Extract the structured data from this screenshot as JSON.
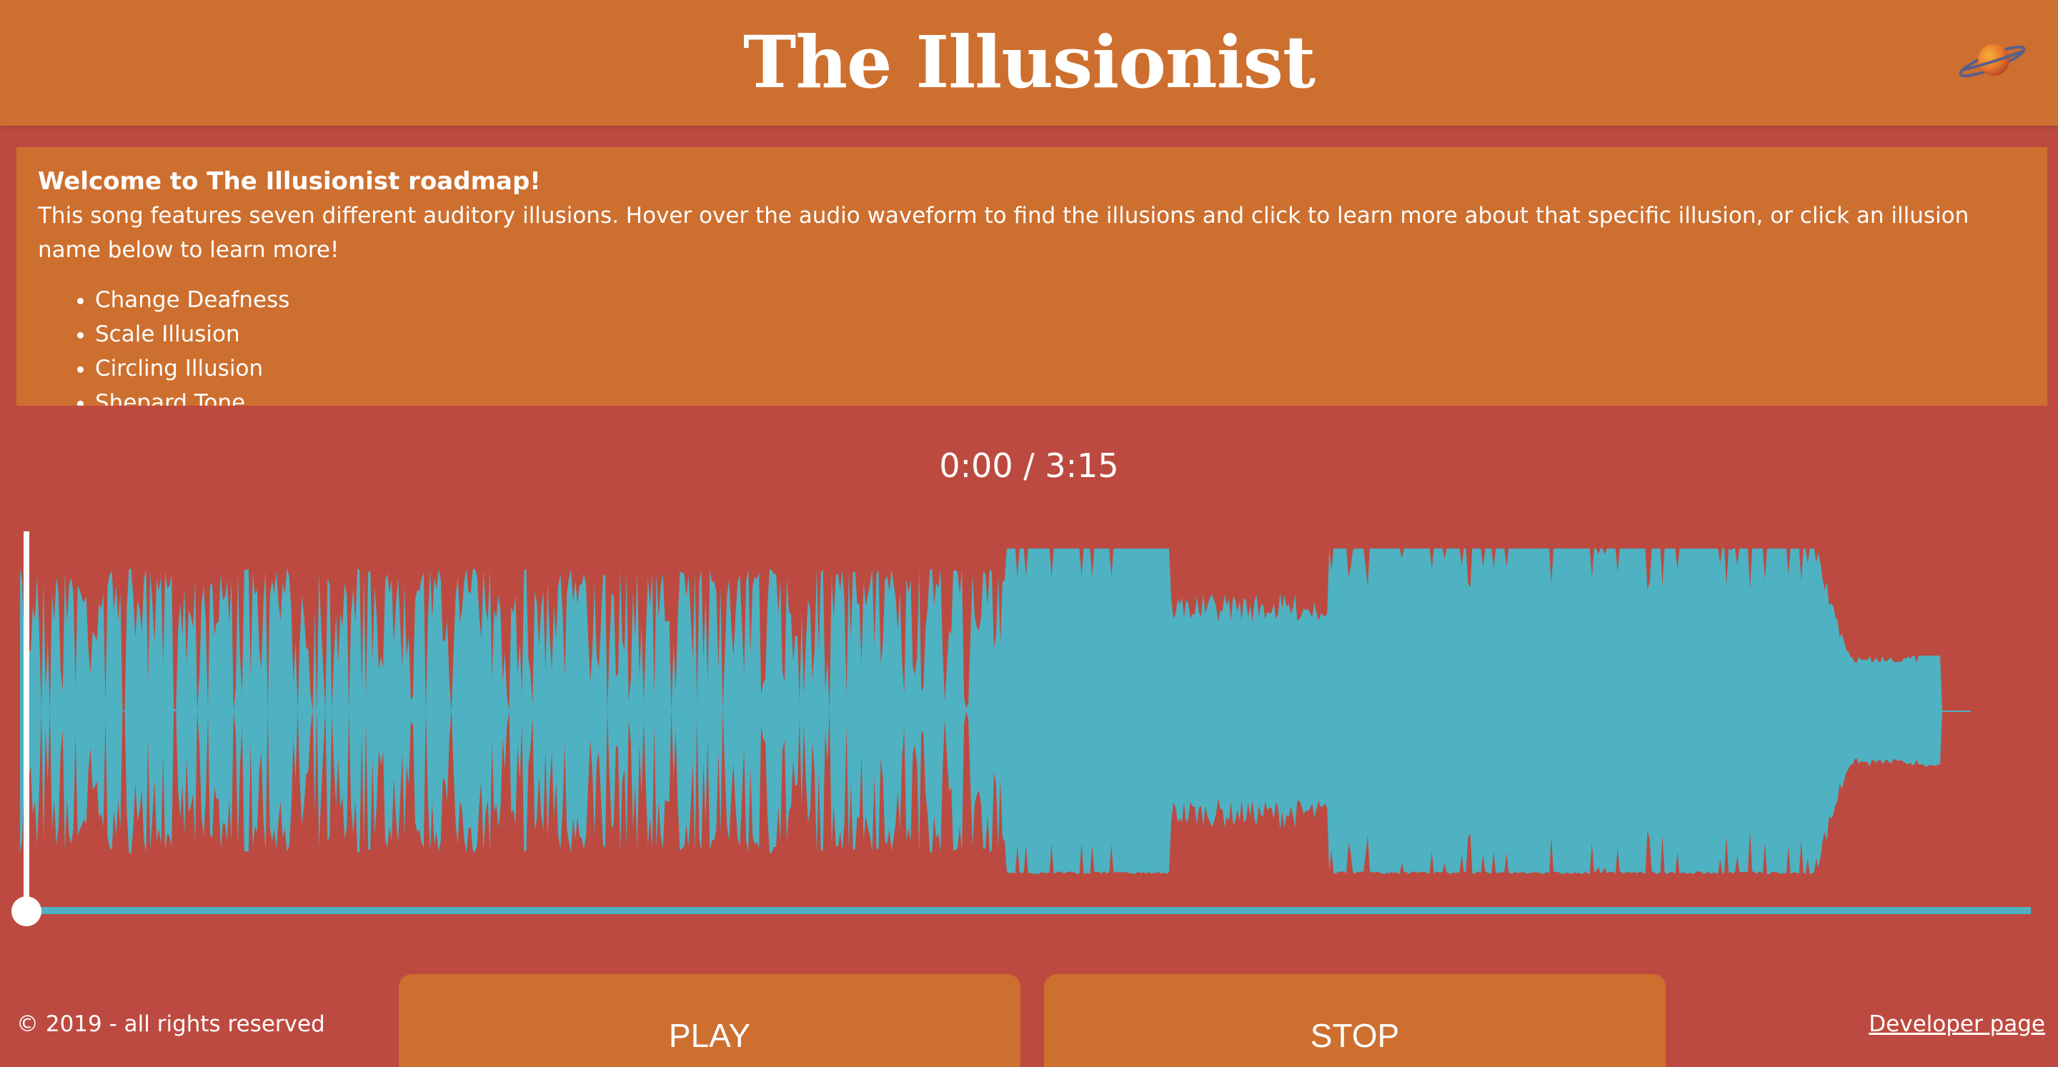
{
  "header": {
    "title": "The Illusionist",
    "logo_icon": "planet-icon"
  },
  "intro": {
    "heading": "Welcome to The Illusionist roadmap!",
    "text": "This song features seven different auditory illusions. Hover over the audio waveform to find the illusions and click to learn more about that specific illusion, or click an illusion name below to learn more!",
    "illusions": [
      "Change Deafness",
      "Scale Illusion",
      "Circling Illusion",
      "Shepard Tone"
    ]
  },
  "player": {
    "time": "0:00 / 3:15",
    "progress": 0,
    "play_label": "PLAY",
    "stop_label": "STOP"
  },
  "footer": {
    "copyright": "© 2019 - all rights reserved",
    "developer_link": "Developer page"
  },
  "colors": {
    "background": "#bd4a40",
    "panel": "#cd6f2f",
    "waveform": "#4eb2c2",
    "text": "#ffffff"
  }
}
